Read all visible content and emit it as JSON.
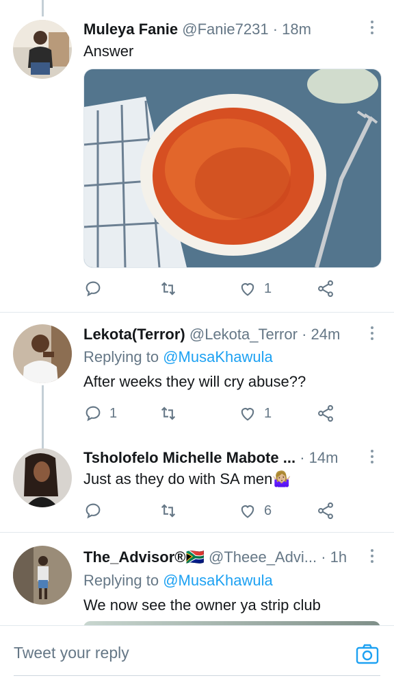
{
  "tweets": [
    {
      "name": "Muleya Fanie",
      "handle": "@Fanie7231",
      "dot": "·",
      "time": "18m",
      "text": "Answer",
      "has_media": true,
      "media_desc": "bowl of jollof rice",
      "actions": {
        "reply": "",
        "retweet": "",
        "like": "1"
      }
    },
    {
      "name": "Lekota(Terror)",
      "handle": "@Lekota_Terror",
      "dot": "·",
      "time": "24m",
      "replying_prefix": "Replying to",
      "replying_to": "@MusaKhawula",
      "text": "After weeks they will cry abuse??",
      "actions": {
        "reply": "1",
        "retweet": "",
        "like": "1"
      }
    },
    {
      "name": "Tsholofelo Michelle Mabote ...",
      "handle": "",
      "dot": "·",
      "time": "14m",
      "text": "Just as they do with SA men🤷🏼‍♀️",
      "actions": {
        "reply": "",
        "retweet": "",
        "like": "6"
      }
    },
    {
      "name": "The_Advisor®🇿🇦",
      "handle": "@Theee_Advi...",
      "dot": "·",
      "time": "1h",
      "replying_prefix": "Replying to",
      "replying_to": "@MusaKhawula",
      "text": "We now see the owner ya strip club"
    }
  ],
  "reply_bar": {
    "placeholder": "Tweet your reply",
    "camera_icon": "camera-icon"
  },
  "colors": {
    "link": "#1da1f2",
    "muted": "#657786",
    "icon": "#657786",
    "divider": "#e1e8ed"
  }
}
